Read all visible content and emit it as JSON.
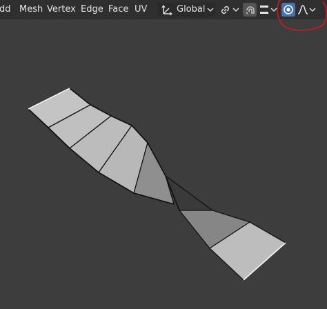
{
  "header": {
    "menus": {
      "add": "dd",
      "mesh": "Mesh",
      "vertex": "Vertex",
      "edge": "Edge",
      "face": "Face",
      "uv": "UV"
    },
    "transform_orientation": "Global",
    "icons": {
      "orientation": "transform-orientation-icon",
      "link": "link-icon",
      "snap": "snap-magnet-icon",
      "snap_target": "snap-target-icon",
      "proportional": "proportional-editing-icon",
      "falloff": "smooth-falloff-curve-icon",
      "chevron": "chevron-down-icon"
    },
    "proportional_editing_enabled": true
  },
  "viewport": {
    "mode": "edit-mode",
    "object": "twisted-plane-strip"
  },
  "annotation": {
    "shape": "red-hand-drawn-circle",
    "color": "#d21a1a"
  },
  "colors": {
    "header_bg": "#2f2f2f",
    "viewport_bg": "#3d3d3d",
    "active_button": "#4772b3",
    "face_light": "#bdbdbd",
    "face_dark": "#8d8d8d",
    "edge": "#111111"
  }
}
